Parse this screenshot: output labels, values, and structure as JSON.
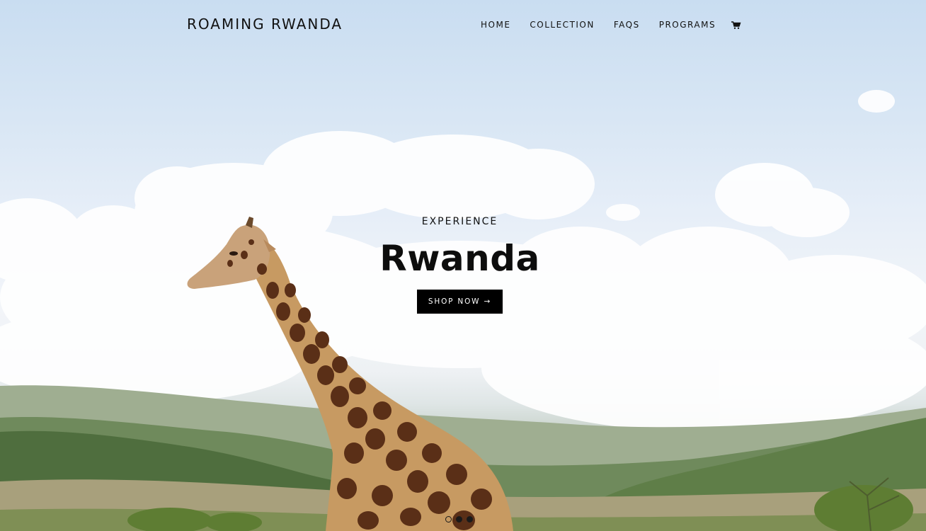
{
  "header": {
    "logo": "ROAMING RWANDA",
    "nav": [
      {
        "label": "HOME"
      },
      {
        "label": "COLLECTION"
      },
      {
        "label": "FAQS"
      },
      {
        "label": "PROGRAMS"
      }
    ],
    "cart_icon": "shopping-cart-icon"
  },
  "hero": {
    "eyebrow": "EXPERIENCE",
    "headline": "Rwanda",
    "cta_label": "SHOP NOW →",
    "background": "giraffe-safari-landscape",
    "slide_count": 3,
    "active_slide": 1
  },
  "colors": {
    "text": "#111111",
    "cta_bg": "#000000",
    "cta_text": "#ffffff",
    "sky": "#c9ddf1"
  }
}
